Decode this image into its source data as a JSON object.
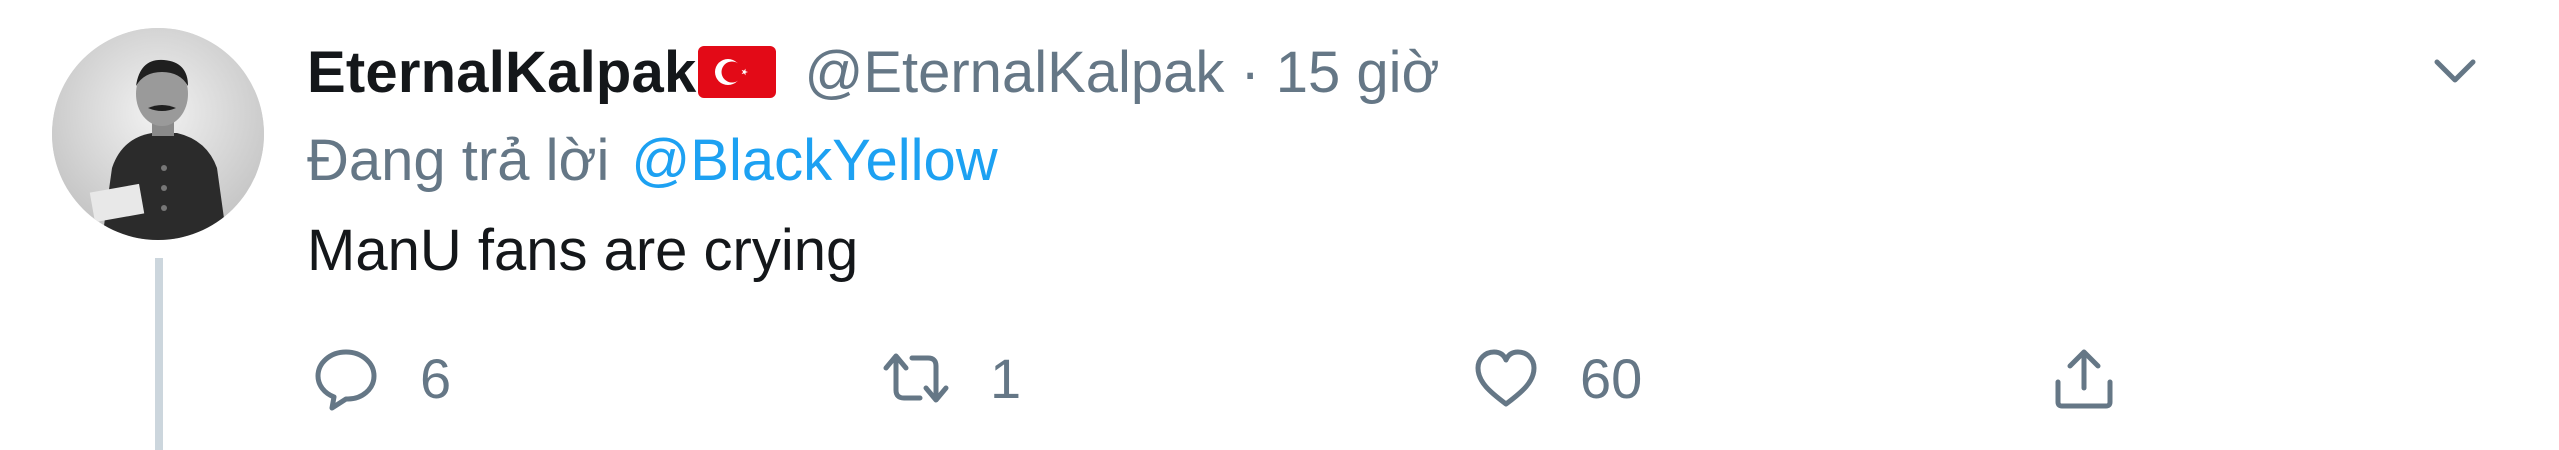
{
  "tweet": {
    "author": {
      "display_name": "EternalKalpak",
      "flag_emoji": "🇹🇷",
      "handle": "@EternalKalpak",
      "separator": "·",
      "timestamp": "15 giờ"
    },
    "reply_context": {
      "prefix": "Đang trả lời",
      "mention": "@BlackYellow"
    },
    "text": "ManU fans are crying",
    "actions": {
      "reply_count": "6",
      "retweet_count": "1",
      "like_count": "60"
    },
    "icons": {
      "reply": "comment-icon",
      "retweet": "retweet-icon",
      "like": "heart-icon",
      "share": "share-icon",
      "more": "chevron-down-icon"
    },
    "colors": {
      "text": "#14171a",
      "secondary": "#657786",
      "link": "#1da1f2",
      "flag_red": "#e30a17",
      "thread_line": "#ccd6dd"
    }
  }
}
